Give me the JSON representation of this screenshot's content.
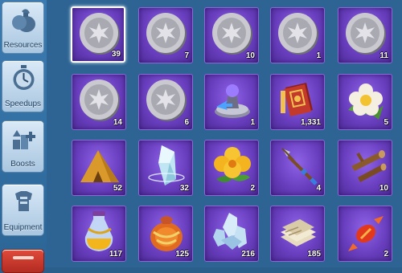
{
  "sidebar": {
    "items": [
      {
        "label": "Resources",
        "icon": "resources-bag-icon"
      },
      {
        "label": "Speedups",
        "icon": "stopwatch-icon"
      },
      {
        "label": "Boosts",
        "icon": "boost-arrows-icon"
      },
      {
        "label": "Equipment",
        "icon": "armor-icon"
      }
    ]
  },
  "grid": {
    "rows": [
      [
        {
          "icon": "silver-coin-icon",
          "count": "39"
        },
        {
          "icon": "silver-coin-icon",
          "count": "7"
        },
        {
          "icon": "silver-coin-icon",
          "count": "10"
        },
        {
          "icon": "silver-coin-icon",
          "count": "1"
        },
        {
          "icon": "silver-coin-icon",
          "count": "11"
        }
      ],
      [
        {
          "icon": "silver-coin-icon",
          "count": "14"
        },
        {
          "icon": "silver-coin-icon",
          "count": "6"
        },
        {
          "icon": "teleport-device-icon",
          "count": "1"
        },
        {
          "icon": "red-tome-icon",
          "count": "1,331"
        },
        {
          "icon": "white-flower-icon",
          "count": "5"
        }
      ],
      [
        {
          "icon": "golden-tent-icon",
          "count": "52"
        },
        {
          "icon": "crystal-shard-icon",
          "count": "32"
        },
        {
          "icon": "yellow-flower-icon",
          "count": "2"
        },
        {
          "icon": "spear-icon",
          "count": "4"
        },
        {
          "icon": "wood-branch-icon",
          "count": "10"
        }
      ],
      [
        {
          "icon": "potion-bottle-icon",
          "count": "117"
        },
        {
          "icon": "orange-sack-icon",
          "count": "125"
        },
        {
          "icon": "crystal-cluster-icon",
          "count": "216"
        },
        {
          "icon": "scroll-bundle-icon",
          "count": "185"
        },
        {
          "icon": "candy-icon",
          "count": "2"
        }
      ]
    ]
  }
}
